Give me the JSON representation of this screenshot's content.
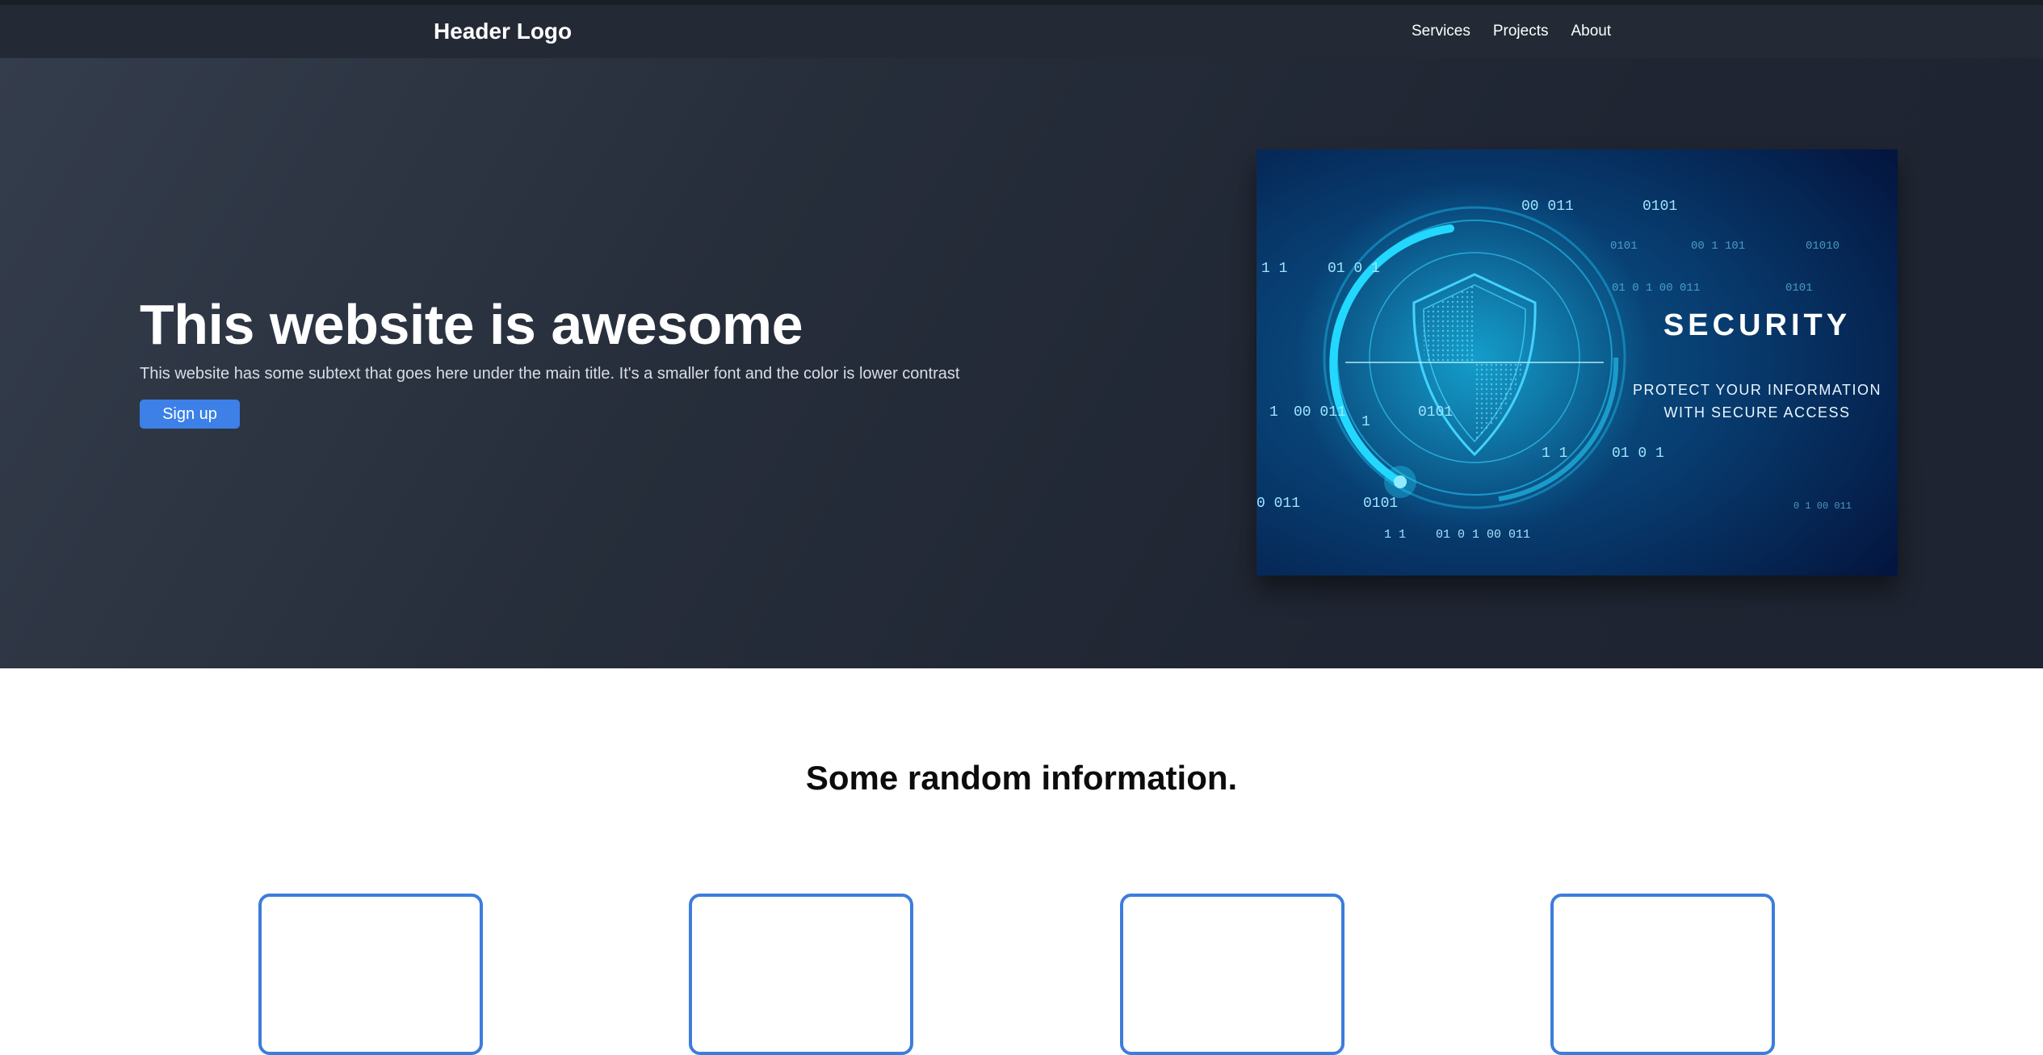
{
  "header": {
    "logo": "Header Logo",
    "nav": [
      {
        "label": "Services"
      },
      {
        "label": "Projects"
      },
      {
        "label": "About"
      }
    ]
  },
  "hero": {
    "title": "This website is awesome",
    "subtitle": "This website has some subtext that goes here under the main title. It's a smaller font and the color is lower contrast",
    "cta_label": "Sign up",
    "image": {
      "heading": "SECURITY",
      "tagline_1": "PROTECT YOUR INFORMATION",
      "tagline_2": "WITH SECURE ACCESS",
      "binary": [
        "00 011",
        "0101",
        "1 1",
        "01 0 1",
        "0101",
        "1",
        "00 011",
        "0101",
        "1 1",
        "01 0 1",
        "0 011",
        "0101",
        "1 1",
        "01 0 1 00 011",
        "01 0 1 00 011",
        "0101",
        "0101",
        "00 1 101",
        "01010",
        "0 1 00 011"
      ]
    },
    "colors": {
      "accent": "#3c80e8"
    }
  },
  "info": {
    "title": "Some random information.",
    "card_count_visible": 4,
    "card_border": "#3c7ddb"
  }
}
